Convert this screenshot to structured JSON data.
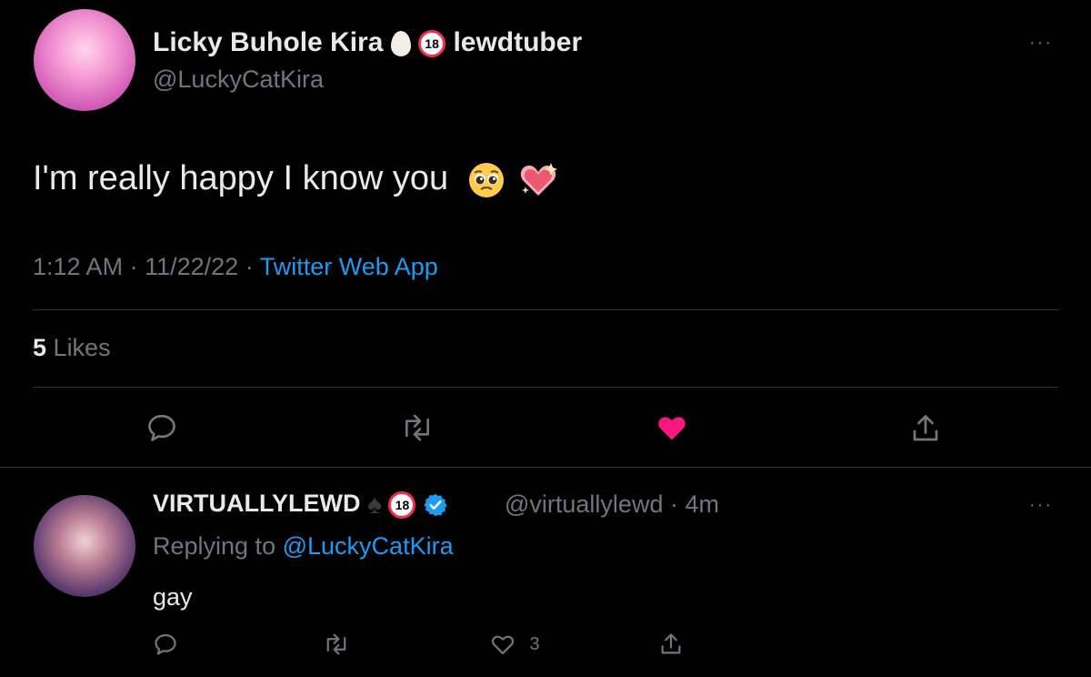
{
  "tweet": {
    "display_name": "Licky Buhole Kira",
    "name_suffix": "lewdtuber",
    "handle": "@LuckyCatKira",
    "text": "I'm really happy I know you",
    "time": "1:12 AM",
    "sep1": "·",
    "date": "11/22/22",
    "sep2": "·",
    "client": "Twitter Web App",
    "likes_count": "5",
    "likes_label": "Likes",
    "more": "···",
    "badge_label": "18",
    "liked_color": "#f91880"
  },
  "reply": {
    "display_name": "VIRTUALLYLEWD",
    "handle": "@virtuallylewd",
    "sep": "·",
    "age": "4m",
    "replying_prefix": "Replying to",
    "replying_to": "@LuckyCatKira",
    "text": "gay",
    "like_count": "3",
    "more": "···",
    "badge_label": "18"
  },
  "colors": {
    "background": "#000000",
    "text": "#e7e9ea",
    "muted": "#71767b",
    "link": "#1d9bf0",
    "divider": "#2f3336"
  },
  "icons": [
    "reply-icon",
    "retweet-icon",
    "like-icon",
    "share-icon",
    "more-icon",
    "verified-icon",
    "egg-icon",
    "spade-icon",
    "adult-18-icon"
  ]
}
